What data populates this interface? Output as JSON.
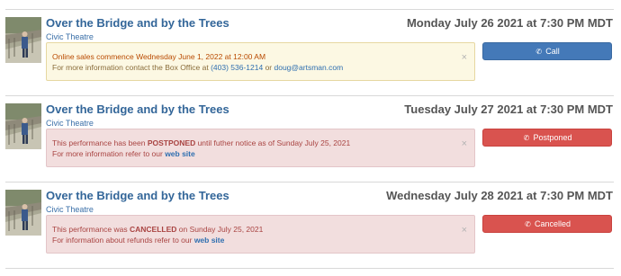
{
  "events": [
    {
      "title": "Over the Bridge and by the Trees",
      "venue": "Civic Theatre",
      "date": "Monday July 26 2021 at 7:30 PM MDT",
      "alert_line1": "Online sales commence Wednesday June 1, 2022 at 12:00 AM",
      "alert_line2_prefix": "For more information contact the Box Office at ",
      "alert_phone": "(403) 536-1214",
      "alert_or": " or ",
      "alert_email": "doug@artsman.com",
      "close": "×",
      "button_icon": "phone-icon",
      "button_label": "Call",
      "button_color": "#4479b8"
    },
    {
      "title": "Over the Bridge and by the Trees",
      "venue": "Civic Theatre",
      "date": "Tuesday July 27 2021 at 7:30 PM MDT",
      "alert_line1_a": "This performance has been ",
      "alert_line1_b": "POSTPONED",
      "alert_line1_c": " until futher notice as of Sunday July 25, 2021",
      "alert_line2_prefix": "For more information refer to our ",
      "alert_link": "web site",
      "close": "×",
      "button_icon": "phone-icon",
      "button_label": "Postponed",
      "button_color": "#d9534f"
    },
    {
      "title": "Over the Bridge and by the Trees",
      "venue": "Civic Theatre",
      "date": "Wednesday July 28 2021 at 7:30 PM MDT",
      "alert_line1_a": "This performance was ",
      "alert_line1_b": "CANCELLED",
      "alert_line1_c": " on Sunday July 25, 2021",
      "alert_line2_prefix": "For information about refunds refer to our ",
      "alert_link": "web site",
      "close": "×",
      "button_icon": "phone-icon",
      "button_label": "Cancelled",
      "button_color": "#d9534f"
    }
  ]
}
